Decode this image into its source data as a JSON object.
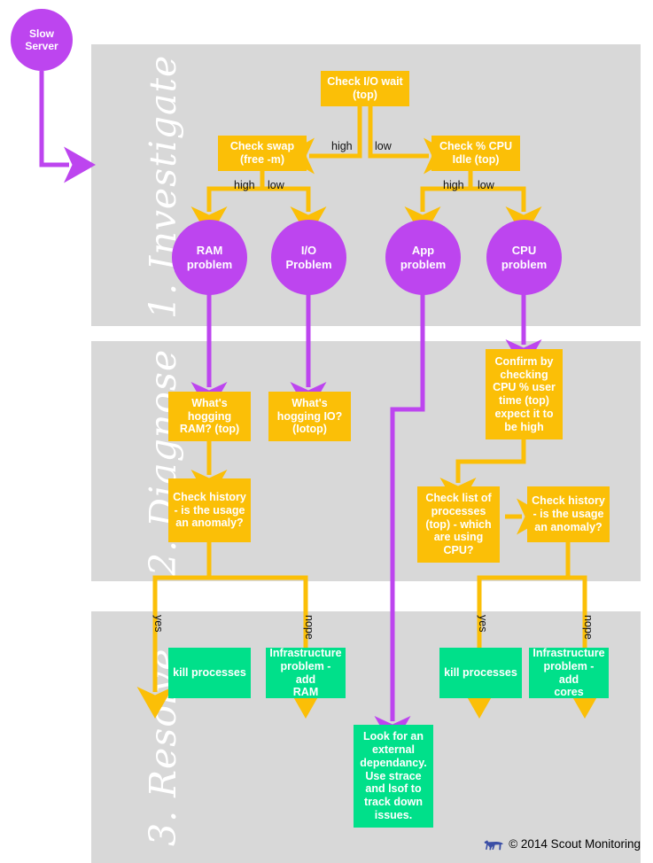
{
  "colors": {
    "panel": "#d8d8d8",
    "yellow": "#fbbf07",
    "green": "#00e08a",
    "purple": "#bd45ef",
    "page": "#ffffff",
    "logo": "#3b4fa6"
  },
  "start": {
    "label": "Slow\nServer"
  },
  "bands": [
    {
      "id": "investigate",
      "label": "1. Investigate"
    },
    {
      "id": "diagnose",
      "label": "2. Diagnose"
    },
    {
      "id": "resolve",
      "label": "3. Resolve"
    }
  ],
  "investigate": {
    "check_io_wait": "Check I/O wait\n(top)",
    "check_swap": "Check swap\n(free -m)",
    "check_cpu_idle": "Check % CPU\nIdle (top)",
    "edges": {
      "io_high": "high",
      "io_low": "low",
      "swap_high": "high",
      "swap_low": "low",
      "cpu_high": "high",
      "cpu_low": "low"
    },
    "problems": [
      {
        "id": "ram",
        "label": "RAM\nproblem"
      },
      {
        "id": "io",
        "label": "I/O\nProblem"
      },
      {
        "id": "app",
        "label": "App\nproblem"
      },
      {
        "id": "cpu",
        "label": "CPU\nproblem"
      }
    ]
  },
  "diagnose": {
    "hogging_ram": "What's\nhogging\nRAM? (top)",
    "hogging_io": "What's\nhogging IO?\n(Iotop)",
    "check_history_ram": "Check history\n- is the usage\nan anomaly?",
    "confirm_cpu": "Confirm by\nchecking\nCPU % user\ntime (top)\nexpect it to\nbe high",
    "check_list_processes": "Check list of\nprocesses\n(top) - which\nare using\nCPU?",
    "check_history_cpu": "Check history\n- is the usage\nan anomaly?"
  },
  "resolve": {
    "kill_processes_ram": "kill processes",
    "infra_add_ram": "Infrastructure\nproblem - add\nRAM",
    "kill_processes_cpu": "kill processes",
    "infra_add_cores": "Infrastructure\nproblem - add\ncores",
    "external_dependency": "Look for an\nexternal\ndependancy.\nUse strace\nand lsof to\ntrack down\nissues.",
    "edges": {
      "ram_yes": "yes",
      "ram_nope": "nope",
      "cpu_yes": "yes",
      "cpu_nope": "nope"
    }
  },
  "footer": {
    "icon": "dog-icon",
    "credit": "© 2014 Scout Monitoring"
  }
}
